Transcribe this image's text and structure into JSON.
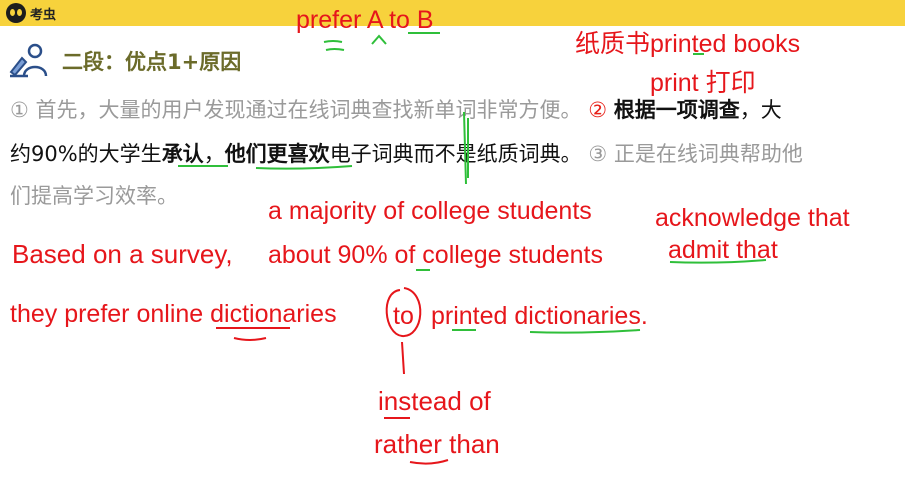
{
  "topbar": {
    "logo_text": "考虫"
  },
  "section": {
    "title": "二段：优点1+原因"
  },
  "paragraph": {
    "s1_num": "①",
    "s1_text": "首先，大量的用户发现通过在线词典查找新单词非常方便。",
    "s2_num": "②",
    "s2_bold1": "根据一项调查",
    "s2_comma1": "，大",
    "s2_line2_a": "约90%的大学生",
    "s2_bold2": "承认",
    "s2_comma2": "，",
    "s2_bold3": "他们更喜欢",
    "s2_line2_b": "电子词典而不是纸质词典。",
    "s3_num": "③",
    "s3_text_line2": "正是在线词典帮助他",
    "s3_text_line3": "们提高学习效率。"
  },
  "annotations": {
    "prefer_a_to_b": "prefer A to B",
    "paper_book": "纸质书printed books",
    "print": "print 打印",
    "majority": "a majority of college students",
    "acknowledge": "acknowledge that",
    "based_on": "Based on a survey,",
    "about_90": "about 90% of college students",
    "admit": "admit that",
    "they_prefer_a": "they prefer online dictionaries",
    "to": "to",
    "printed_dicts": "printed dictionaries.",
    "instead_of": "instead of",
    "rather_than": "rather than"
  },
  "colors": {
    "topbar": "#f7d23c",
    "annotation": "#e6161b",
    "underline": "#2fbf3a",
    "gray_text": "#9a9a9a",
    "title": "#6b6b2a"
  }
}
